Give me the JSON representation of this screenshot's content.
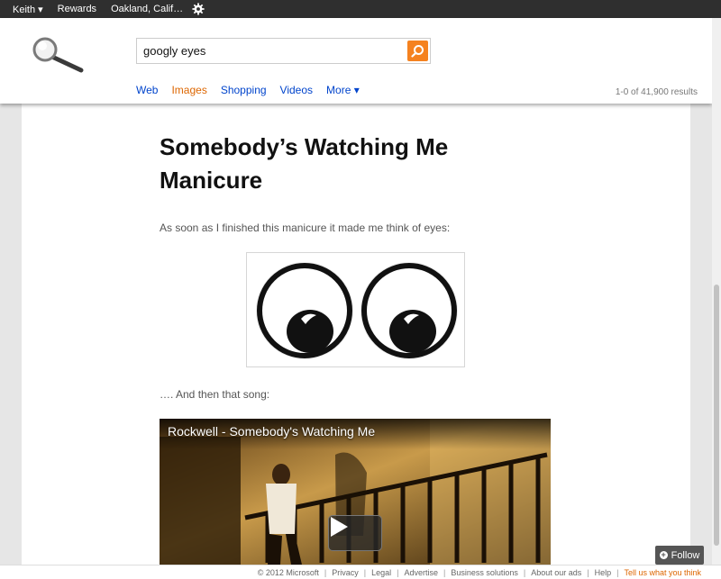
{
  "topbar": {
    "user": "Keith ▾",
    "rewards": "Rewards",
    "location": "Oakland, Calif…",
    "settings_icon": "gear-icon"
  },
  "search": {
    "query": "googly eyes",
    "button_icon": "search-icon"
  },
  "nav": {
    "web": "Web",
    "images": "Images",
    "shopping": "Shopping",
    "videos": "Videos",
    "more": "More ▾"
  },
  "results": {
    "count": "1-0 of 41,900 results"
  },
  "post": {
    "title": "Somebody’s Watching Me Manicure",
    "intro": "As soon as I finished this manicure it made me think of eyes:",
    "then": "…. And then that song:"
  },
  "video": {
    "title": "Rockwell - Somebody's Watching Me",
    "play_icon": "play-icon"
  },
  "follow": {
    "label": "Follow"
  },
  "footer": {
    "copyright": "© 2012 Microsoft",
    "privacy": "Privacy",
    "legal": "Legal",
    "advertise": "Advertise",
    "business": "Business solutions",
    "about_ads": "About our ads",
    "help": "Help",
    "feedback": "Tell us what you think"
  },
  "colors": {
    "topbar": "#2f2f2f",
    "accent": "#f5821f",
    "link": "#0044cc",
    "active_tab": "#dd6600"
  }
}
